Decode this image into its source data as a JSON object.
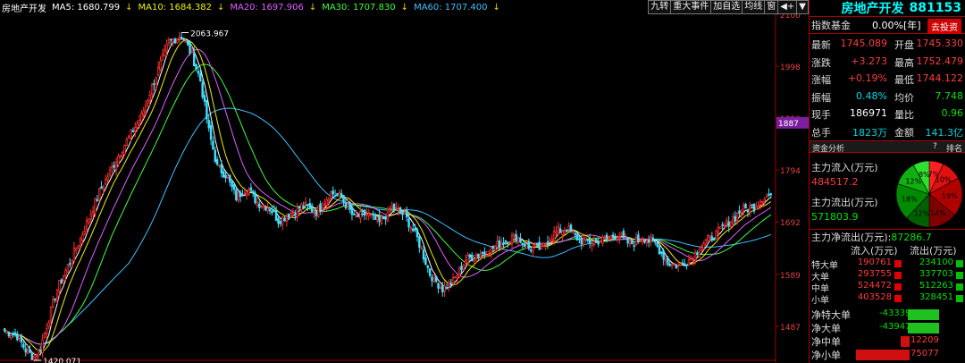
{
  "header": {
    "name": "房地产开发",
    "ma": [
      {
        "label": "MA5: 1680.799",
        "color": "#ffffff"
      },
      {
        "label": "MA10: 1684.382",
        "color": "#f0f000"
      },
      {
        "label": "MA20: 1697.906",
        "color": "#e060ff"
      },
      {
        "label": "MA30: 1707.830",
        "color": "#40ff40"
      },
      {
        "label": "MA60: 1707.400",
        "color": "#40c0ff"
      }
    ],
    "toolbar": [
      "九转",
      "重大事件",
      "加自选",
      "均线",
      "窗",
      "◀+",
      "▼"
    ]
  },
  "chart_data": {
    "type": "candlestick",
    "ylim": [
      1420,
      2100
    ],
    "y_ticks": [
      "2100",
      "1998",
      "1896",
      "1794",
      "1692",
      "1589",
      "1487"
    ],
    "current_price_label": "1887",
    "annotations": [
      {
        "text": "2063.967",
        "value": 2063.967
      },
      {
        "text": "1420.071",
        "value": 1420.071
      }
    ],
    "colors": {
      "up": "#ff3030",
      "down": "#40e0ff",
      "ma5": "#ffffff",
      "ma10": "#f0f000",
      "ma20": "#e060ff",
      "ma30": "#40ff40",
      "ma60": "#40c0ff"
    },
    "anchors": [
      [
        0,
        1478
      ],
      [
        6,
        1468
      ],
      [
        10,
        1440
      ],
      [
        14,
        1425
      ],
      [
        17,
        1445
      ],
      [
        25,
        1560
      ],
      [
        35,
        1650
      ],
      [
        45,
        1750
      ],
      [
        55,
        1830
      ],
      [
        65,
        1900
      ],
      [
        72,
        1980
      ],
      [
        78,
        2045
      ],
      [
        84,
        2060
      ],
      [
        89,
        2020
      ],
      [
        93,
        1970
      ],
      [
        97,
        1870
      ],
      [
        101,
        1800
      ],
      [
        105,
        1785
      ],
      [
        110,
        1740
      ],
      [
        115,
        1760
      ],
      [
        120,
        1730
      ],
      [
        126,
        1720
      ],
      [
        130,
        1695
      ],
      [
        136,
        1710
      ],
      [
        142,
        1725
      ],
      [
        148,
        1712
      ],
      [
        155,
        1750
      ],
      [
        160,
        1740
      ],
      [
        166,
        1700
      ],
      [
        172,
        1708
      ],
      [
        178,
        1690
      ],
      [
        184,
        1720
      ],
      [
        190,
        1705
      ],
      [
        196,
        1660
      ],
      [
        202,
        1590
      ],
      [
        208,
        1560
      ],
      [
        213,
        1575
      ],
      [
        219,
        1618
      ],
      [
        225,
        1628
      ],
      [
        231,
        1638
      ],
      [
        237,
        1655
      ],
      [
        243,
        1664
      ],
      [
        249,
        1640
      ],
      [
        255,
        1640
      ],
      [
        261,
        1670
      ],
      [
        267,
        1680
      ],
      [
        273,
        1656
      ],
      [
        279,
        1652
      ],
      [
        285,
        1658
      ],
      [
        291,
        1668
      ],
      [
        297,
        1648
      ],
      [
        303,
        1662
      ],
      [
        309,
        1650
      ],
      [
        315,
        1612
      ],
      [
        320,
        1605
      ],
      [
        326,
        1620
      ],
      [
        332,
        1650
      ],
      [
        338,
        1668
      ],
      [
        344,
        1692
      ],
      [
        350,
        1715
      ],
      [
        356,
        1722
      ],
      [
        360,
        1740
      ],
      [
        364,
        1745
      ]
    ]
  },
  "panel": {
    "title": "房地产开发",
    "code": "881153",
    "fund_label": "指数基金",
    "fund_value": "0.00%[年]",
    "fund_button": "去投资",
    "quotes": [
      {
        "l": "最新",
        "v1": "1745.089",
        "c1": "red",
        "m": "开盘",
        "v2": "1745.330",
        "c2": "red"
      },
      {
        "l": "涨跌",
        "v1": "+3.273",
        "c1": "red",
        "m": "最高",
        "v2": "1752.479",
        "c2": "red"
      },
      {
        "l": "涨幅",
        "v1": "+0.19%",
        "c1": "red",
        "m": "最低",
        "v2": "1744.122",
        "c2": "red"
      },
      {
        "l": "振幅",
        "v1": "0.48%",
        "c1": "cyan",
        "m": "均价",
        "v2": "7.748",
        "c2": "green"
      },
      {
        "l": "现手",
        "v1": "186971",
        "c1": "white",
        "m": "量比",
        "v2": "0.96",
        "c2": "green"
      },
      {
        "l": "总手",
        "v1": "1823万",
        "c1": "cyan",
        "m": "金额",
        "v2": "141.3亿",
        "c2": "cyan"
      }
    ],
    "section": {
      "label": "资金分析",
      "help": "?",
      "rank": "排名"
    },
    "inflow_label": "主力流入(万元)",
    "inflow_value": "484517.2",
    "outflow_label": "主力流出(万元)",
    "outflow_value": "571803.9",
    "net_label": "主力净流出(万元):",
    "net_value": "87286.7",
    "pie": [
      {
        "label": "7%",
        "value": 7,
        "color": "#ff2020"
      },
      {
        "label": "10%",
        "value": 10,
        "color": "#e01010"
      },
      {
        "label": "19%",
        "value": 19,
        "color": "#b00000"
      },
      {
        "label": "14%",
        "value": 14,
        "color": "#800000"
      },
      {
        "label": "12%",
        "value": 12,
        "color": "#006000"
      },
      {
        "label": "18%",
        "value": 18,
        "color": "#008a00"
      },
      {
        "label": "12%",
        "value": 12,
        "color": "#10b010"
      },
      {
        "label": "8%",
        "value": 8,
        "color": "#30e030"
      }
    ],
    "table_head": {
      "in": "流入(万元)",
      "out": "流出(万元)"
    },
    "rows": [
      {
        "l": "特大单",
        "in": "190761",
        "out": "234100"
      },
      {
        "l": "大单",
        "in": "293755",
        "out": "337703"
      },
      {
        "l": "中单",
        "in": "524472",
        "out": "512263"
      },
      {
        "l": "小单",
        "in": "403528",
        "out": "328451"
      }
    ],
    "nets": [
      {
        "l": "净特大单",
        "v": "-43339",
        "n": -43339
      },
      {
        "l": "净大单",
        "v": "-43947",
        "n": -43947
      },
      {
        "l": "净中单",
        "v": "12209",
        "n": 12209
      },
      {
        "l": "净小单",
        "v": "75077",
        "n": 75077
      }
    ]
  }
}
